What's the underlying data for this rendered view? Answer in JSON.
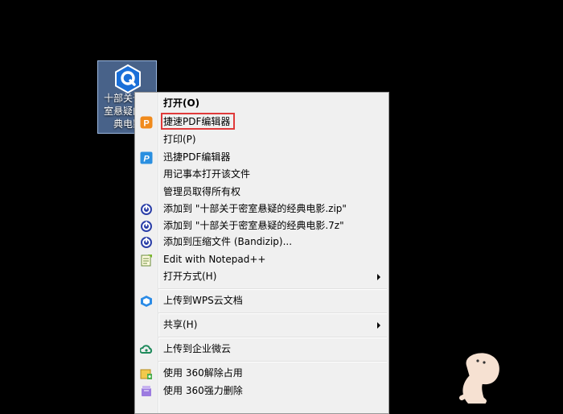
{
  "desktop": {
    "icon_label": "十部关于密室悬疑的经典电影",
    "icon": "app-q-icon"
  },
  "menu": {
    "items": [
      {
        "label": "打开(O)",
        "icon": ""
      },
      {
        "label": "捷速PDF编辑器",
        "icon": "jiesu-pdf-icon"
      },
      {
        "label": "打印(P)",
        "icon": ""
      },
      {
        "label": "迅捷PDF编辑器",
        "icon": "xunjie-pdf-icon"
      },
      {
        "label": "用记事本打开该文件",
        "icon": ""
      },
      {
        "label": "管理员取得所有权",
        "icon": ""
      },
      {
        "label": "添加到 \"十部关于密室悬疑的经典电影.zip\"",
        "icon": "bandizip-icon"
      },
      {
        "label": "添加到 \"十部关于密室悬疑的经典电影.7z\"",
        "icon": "bandizip-icon"
      },
      {
        "label": "添加到压缩文件 (Bandizip)...",
        "icon": "bandizip-icon"
      },
      {
        "label": "Edit with Notepad++",
        "icon": "notepadpp-icon"
      },
      {
        "label": "打开方式(H)",
        "icon": "submenu-arrow"
      },
      {
        "label": "上传到WPS云文档",
        "icon": "wps-cloud-icon"
      },
      {
        "label": "共享(H)",
        "icon": "submenu-arrow"
      },
      {
        "label": "上传到企业微云",
        "icon": "weiyun-icon"
      },
      {
        "label": "使用 360解除占用",
        "icon": "360-unlock-icon"
      },
      {
        "label": "使用 360强力删除",
        "icon": "360-delete-icon"
      }
    ],
    "highlight_color": "#e03a3a"
  }
}
